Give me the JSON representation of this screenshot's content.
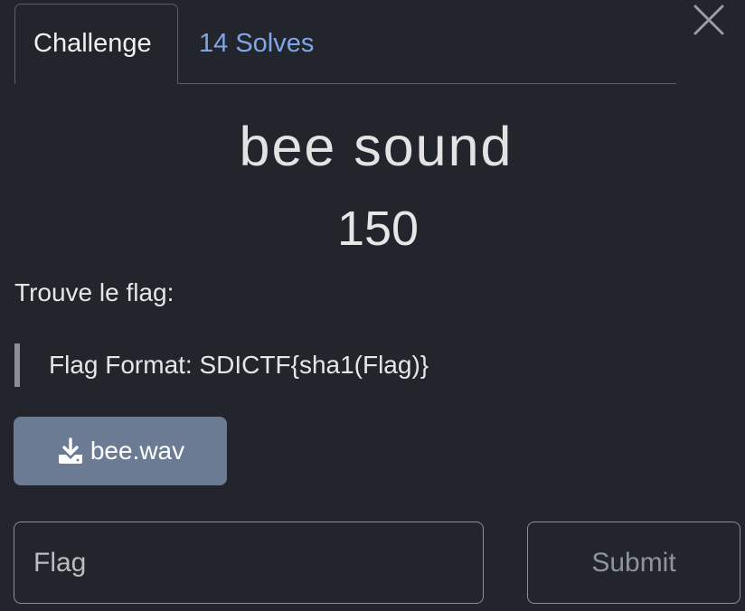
{
  "tabs": {
    "challenge_label": "Challenge",
    "solves_label": "14 Solves"
  },
  "challenge": {
    "name": "bee sound",
    "value": "150",
    "description": "Trouve le flag:",
    "note": "Flag Format: SDICTF{sha1(Flag)}"
  },
  "files": {
    "download_label": "bee.wav"
  },
  "form": {
    "flag_placeholder": "Flag",
    "submit_label": "Submit"
  },
  "icons": {
    "close": "close-icon",
    "download": "download-icon"
  },
  "colors": {
    "background": "#22252b",
    "link": "#7fa6e6",
    "download_button": "#6b7b93"
  }
}
